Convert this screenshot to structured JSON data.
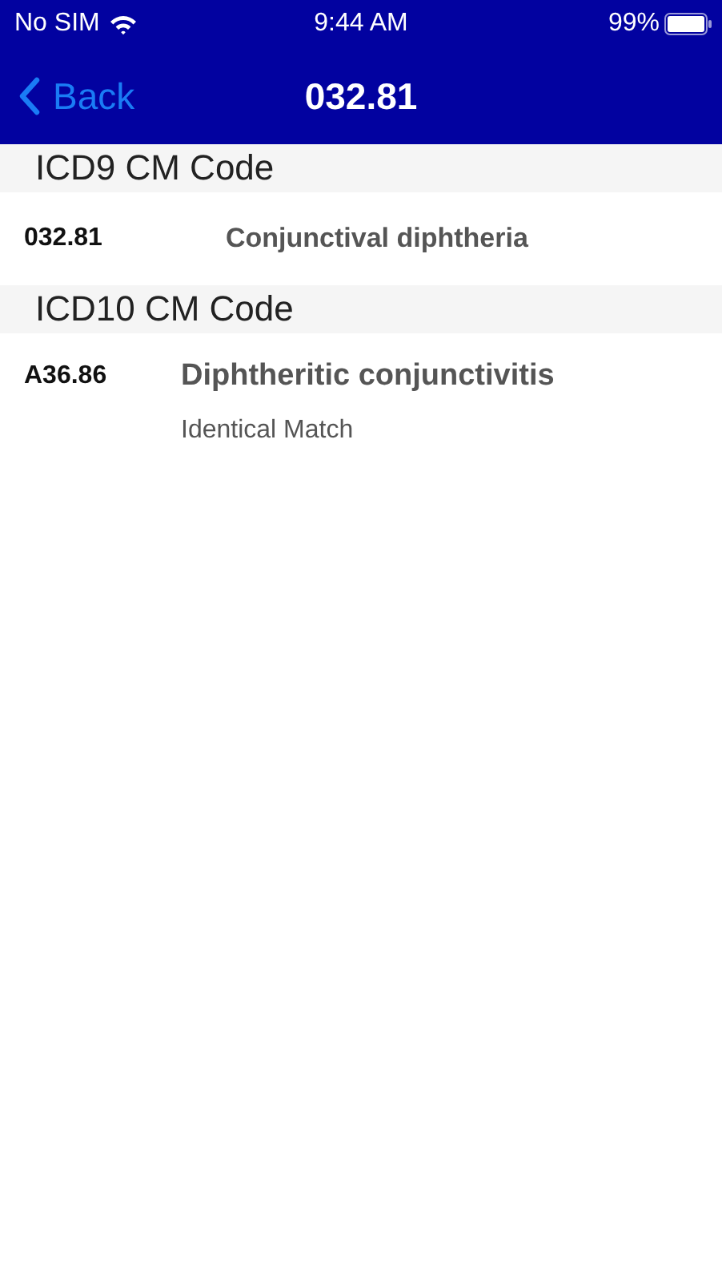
{
  "status_bar": {
    "carrier": "No SIM",
    "time": "9:44 AM",
    "battery": "99%"
  },
  "nav": {
    "back": "Back",
    "title": "032.81"
  },
  "sections": [
    {
      "title": "ICD9 CM Code",
      "rows": [
        {
          "kind": "source",
          "code": "032.81",
          "description": "Conjunctival diphtheria"
        }
      ]
    },
    {
      "title": "ICD10 CM Code",
      "rows": [
        {
          "kind": "match",
          "code": "A36.86",
          "description": "Diphtheritic conjunctivitis",
          "note": "Identical Match"
        }
      ]
    }
  ]
}
